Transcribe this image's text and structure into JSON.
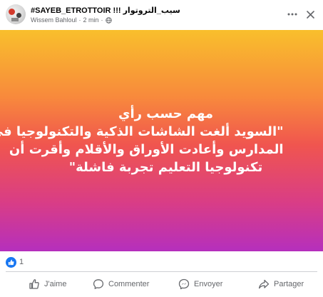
{
  "post": {
    "page_name": "سيب_التروتوار !!! SAYEB_ETROTTOIR#",
    "author": "Wissem Bahloul",
    "time": "2 min",
    "separator": "·",
    "media": {
      "lines": [
        "مهم حسب رأي",
        "\"السويد ألغت الشاشات الذكية والتكنولوجيا في",
        "المدارس وأعادت الأوراق والأقلام وأقرت أن",
        "تكنولوجيا التعليم تجربة فاشلة\""
      ]
    },
    "reactions": {
      "count": "1",
      "icon": "like-icon"
    },
    "actions": {
      "like": "J'aime",
      "comment": "Commenter",
      "send": "Envoyer",
      "share": "Partager"
    }
  },
  "colors": {
    "gradient_top": "#f9bf2c",
    "gradient_mid": "#f0554f",
    "gradient_bottom": "#b52fbd",
    "like_blue": "#1877f2",
    "secondary_text": "#65676b"
  }
}
